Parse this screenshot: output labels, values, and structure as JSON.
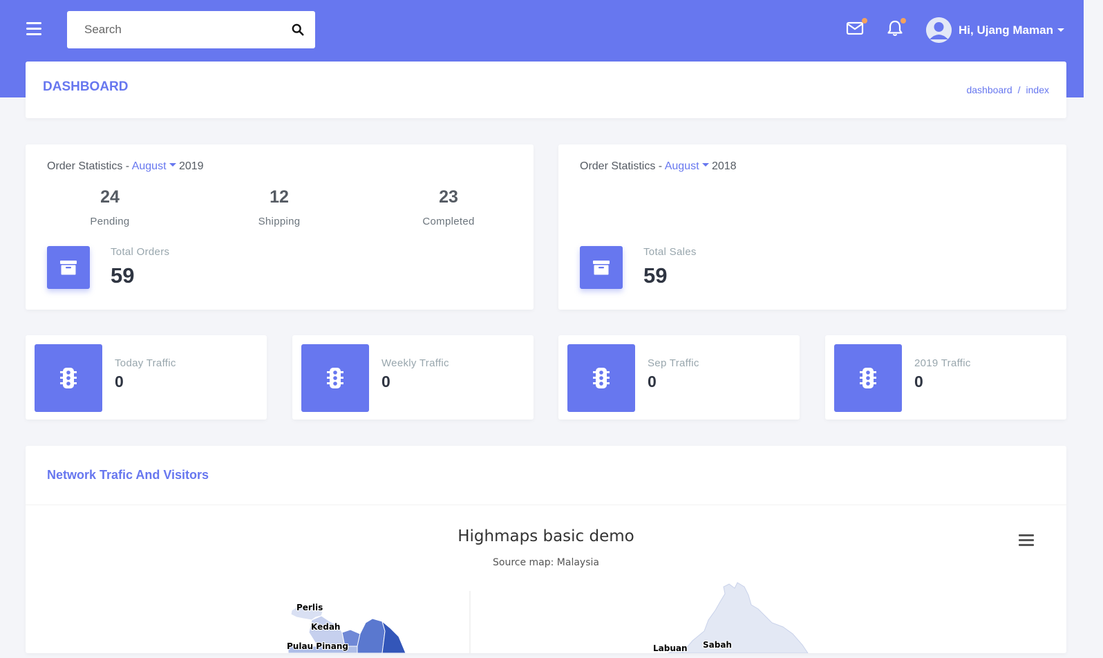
{
  "header": {
    "search_placeholder": "Search",
    "user_greeting": "Hi, Ujang Maman",
    "accent_color": "#6777ef",
    "notification_dot_color": "#f5a25d"
  },
  "page": {
    "title": "DASHBOARD",
    "breadcrumb": [
      "dashboard",
      "index"
    ],
    "breadcrumb_separator": "/"
  },
  "order_stats_2019": {
    "label": "Order Statistics -",
    "month": "August",
    "year": "2019",
    "items": [
      {
        "value": "24",
        "label": "Pending"
      },
      {
        "value": "12",
        "label": "Shipping"
      },
      {
        "value": "23",
        "label": "Completed"
      }
    ],
    "total_label": "Total Orders",
    "total_value": "59"
  },
  "order_stats_2018": {
    "label": "Order Statistics -",
    "month": "August",
    "year": "2018",
    "total_label": "Total Sales",
    "total_value": "59"
  },
  "traffic": [
    {
      "label": "Today Traffic",
      "value": "0"
    },
    {
      "label": "Weekly Traffic",
      "value": "0"
    },
    {
      "label": "Sep Traffic",
      "value": "0"
    },
    {
      "label": "2019 Traffic",
      "value": "0"
    }
  ],
  "map_section": {
    "title": "Network Trafic And Visitors",
    "chart_title": "Highmaps basic demo",
    "chart_subtitle": "Source map: Malaysia",
    "region_labels": {
      "perlis": "Perlis",
      "kedah": "Kedah",
      "pulau_pinang": "Pulau Pinang",
      "labuan": "Labuan",
      "sabah": "Sabah"
    }
  }
}
